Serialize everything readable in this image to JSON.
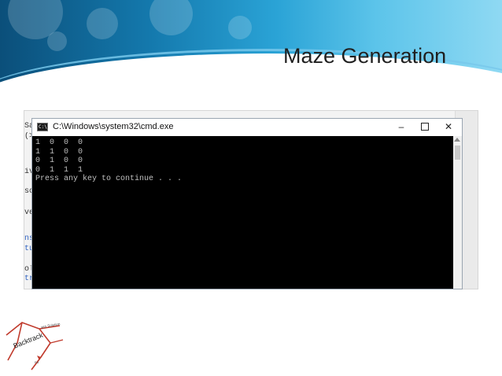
{
  "slide": {
    "title": "Maze Generation"
  },
  "editor": {
    "fragments": [
      "Saf",
      "(>",
      "ive",
      "sc",
      "ver",
      "nsc",
      "tur",
      "olu",
      "tr"
    ]
  },
  "cmd_window": {
    "title": "C:\\Windows\\system32\\cmd.exe",
    "icon_text": "C:\\",
    "buttons": {
      "minimize": "–",
      "close": "✕"
    },
    "output_lines": [
      "1  0  0  0",
      "1  1  0  0",
      "0  1  0  0",
      "0  1  1  1",
      "Press any key to continue . . ."
    ]
  },
  "logo": {
    "text": "Backtrack",
    "annotations": [
      "yes Solution",
      "no"
    ]
  },
  "colors": {
    "banner_dark": "#0b4f7a",
    "banner_light": "#8fd9f3",
    "console_bg": "#000000",
    "console_text": "#c0c0c0",
    "logo_red": "#c0392b"
  },
  "icons": [
    "cmd-icon",
    "minimize-icon",
    "maximize-icon",
    "close-icon",
    "scroll-up-arrow-icon"
  ]
}
